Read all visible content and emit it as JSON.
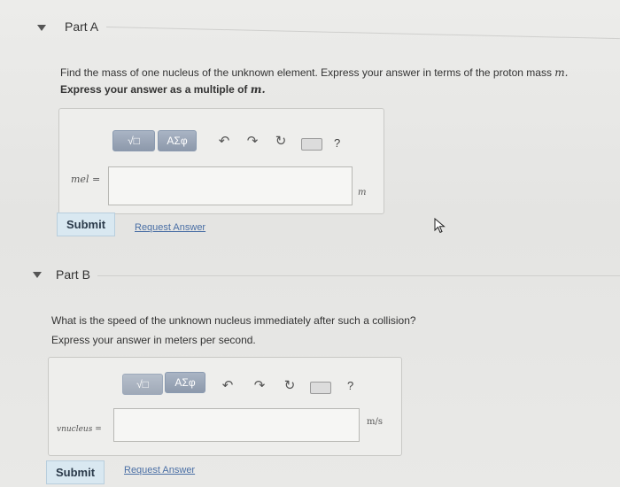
{
  "partA": {
    "title": "Part A",
    "question": "Find the mass of one nucleus of the unknown element. Express your answer in terms of the proton mass ",
    "question_var": "m.",
    "instruction": "Express your answer as a multiple of ",
    "instruction_var": "m.",
    "label": "mel =",
    "unit": "m",
    "submit": "Submit",
    "request": "Request Answer"
  },
  "partB": {
    "title": "Part B",
    "question": "What is the speed of the unknown nucleus immediately after such a collision?",
    "instruction": "Express your answer in meters per second.",
    "label": "vnucleus =",
    "unit": "m/s",
    "submit": "Submit",
    "request": "Request Answer"
  },
  "toolbar": {
    "template_label": "√□",
    "greek_label": "ΑΣφ",
    "undo": "↶",
    "redo": "↷",
    "reset": "↻",
    "help": "?"
  }
}
